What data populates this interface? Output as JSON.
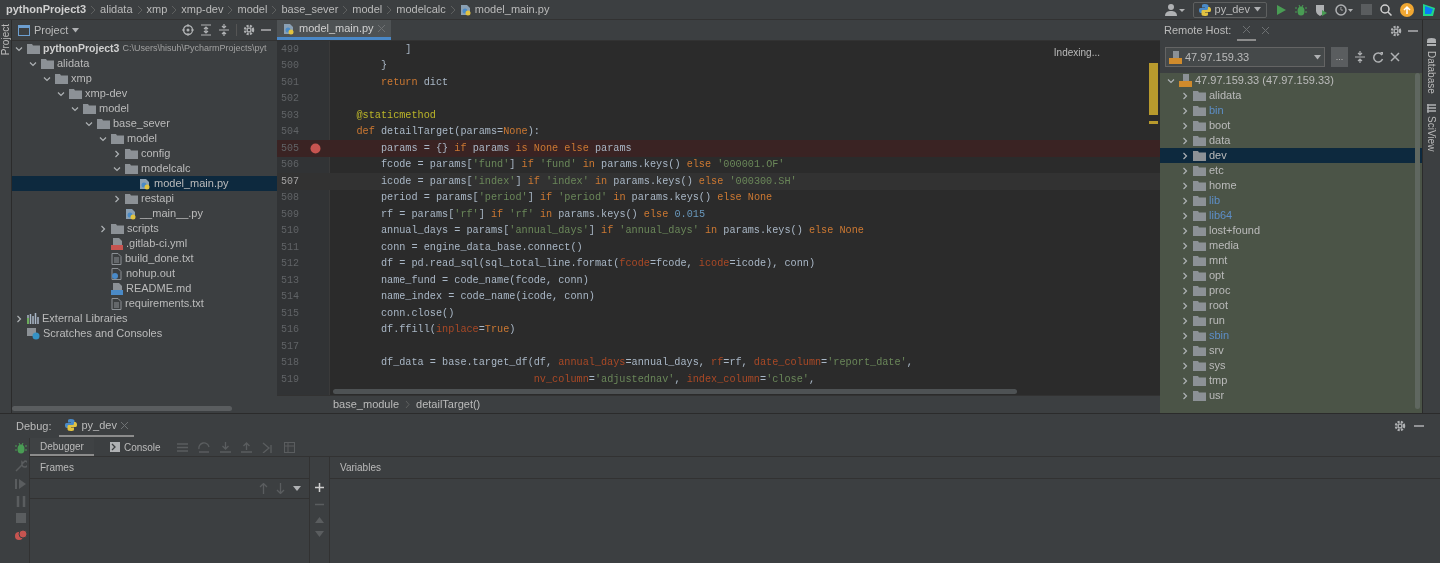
{
  "breadcrumbs": [
    {
      "label": "pythonProject3",
      "kind": "project"
    },
    {
      "label": "alidata",
      "kind": "folder"
    },
    {
      "label": "xmp",
      "kind": "folder"
    },
    {
      "label": "xmp-dev",
      "kind": "folder"
    },
    {
      "label": "model",
      "kind": "folder"
    },
    {
      "label": "base_sever",
      "kind": "folder"
    },
    {
      "label": "model",
      "kind": "folder"
    },
    {
      "label": "modelcalc",
      "kind": "folder"
    },
    {
      "label": "model_main.py",
      "kind": "pyfile"
    }
  ],
  "run_config": {
    "label": "py_dev"
  },
  "side_tab": "Project",
  "project_panel": {
    "title": "Project",
    "tree": [
      {
        "label": "pythonProject3",
        "path": "C:\\Users\\hisuh\\PycharmProjects\\pyt",
        "kind": "folder",
        "expanded": true,
        "selected": false,
        "children": [
          {
            "label": "alidata",
            "kind": "folder",
            "expanded": true,
            "selected": false,
            "children": [
              {
                "label": "xmp",
                "kind": "folder",
                "expanded": true,
                "selected": false,
                "children": [
                  {
                    "label": "xmp-dev",
                    "kind": "folder",
                    "expanded": true,
                    "selected": false,
                    "children": [
                      {
                        "label": "model",
                        "kind": "folder",
                        "expanded": true,
                        "selected": false,
                        "children": [
                          {
                            "label": "base_sever",
                            "kind": "folder",
                            "expanded": true,
                            "selected": false,
                            "children": [
                              {
                                "label": "model",
                                "kind": "folder",
                                "expanded": true,
                                "selected": false,
                                "children": [
                                  {
                                    "label": "config",
                                    "kind": "folder",
                                    "expanded": false,
                                    "selected": false
                                  },
                                  {
                                    "label": "modelcalc",
                                    "kind": "folder",
                                    "expanded": true,
                                    "selected": false,
                                    "children": [
                                      {
                                        "label": "model_main.py",
                                        "kind": "pyfile",
                                        "selected": true
                                      }
                                    ]
                                  },
                                  {
                                    "label": "restapi",
                                    "kind": "folder",
                                    "expanded": false,
                                    "selected": false
                                  },
                                  {
                                    "label": "__main__.py",
                                    "kind": "pyfile",
                                    "selected": false
                                  }
                                ]
                              },
                              {
                                "label": "scripts",
                                "kind": "folder",
                                "expanded": false,
                                "selected": false
                              },
                              {
                                "label": ".gitlab-ci.yml",
                                "kind": "yml",
                                "selected": false
                              },
                              {
                                "label": "build_done.txt",
                                "kind": "text",
                                "selected": false
                              },
                              {
                                "label": "nohup.out",
                                "kind": "out",
                                "selected": false
                              },
                              {
                                "label": "README.md",
                                "kind": "md",
                                "selected": false
                              },
                              {
                                "label": "requirements.txt",
                                "kind": "text",
                                "selected": false
                              }
                            ]
                          }
                        ]
                      }
                    ]
                  }
                ]
              }
            ]
          }
        ]
      },
      {
        "label": "External Libraries",
        "kind": "libraries",
        "expanded": false,
        "selected": false
      },
      {
        "label": "Scratches and Consoles",
        "kind": "scratches",
        "selected": false
      }
    ]
  },
  "editor": {
    "tabs": [
      {
        "label": "model_main.py",
        "selected": true
      }
    ],
    "status": "Indexing...",
    "lines": [
      {
        "number": "499",
        "breakpoint": false,
        "current": false,
        "tokens": [
          {
            "text": "            ]",
            "kind": "plain"
          }
        ]
      },
      {
        "number": "500",
        "breakpoint": false,
        "current": false,
        "tokens": [
          {
            "text": "        }",
            "kind": "plain"
          }
        ]
      },
      {
        "number": "501",
        "breakpoint": false,
        "current": false,
        "tokens": [
          {
            "text": "        return",
            "kind": "keyword"
          },
          {
            "text": " dict",
            "kind": "plain"
          }
        ]
      },
      {
        "number": "502",
        "breakpoint": false,
        "current": false
      },
      {
        "number": "503",
        "breakpoint": false,
        "current": false,
        "tokens": [
          {
            "text": "    @staticmethod",
            "kind": "decorator"
          }
        ]
      },
      {
        "number": "504",
        "breakpoint": false,
        "current": false,
        "tokens": [
          {
            "text": "    def",
            "kind": "keyword"
          },
          {
            "text": " detailTarget(params=",
            "kind": "plain"
          },
          {
            "text": "None",
            "kind": "keyword"
          },
          {
            "text": "):",
            "kind": "plain"
          }
        ]
      },
      {
        "number": "505",
        "breakpoint": true,
        "current": false,
        "tokens": [
          {
            "text": "        params = {} ",
            "kind": "plain"
          },
          {
            "text": "if",
            "kind": "keyword"
          },
          {
            "text": " params ",
            "kind": "plain"
          },
          {
            "text": "is None else",
            "kind": "keyword"
          },
          {
            "text": " params",
            "kind": "plain"
          }
        ]
      },
      {
        "number": "506",
        "breakpoint": false,
        "current": false,
        "tokens": [
          {
            "text": "        fcode = params[",
            "kind": "plain"
          },
          {
            "text": "'fund'",
            "kind": "string"
          },
          {
            "text": "] ",
            "kind": "plain"
          },
          {
            "text": "if",
            "kind": "keyword"
          },
          {
            "text": " 'fund' ",
            "kind": "string"
          },
          {
            "text": "in",
            "kind": "keyword"
          },
          {
            "text": " params.keys() ",
            "kind": "plain"
          },
          {
            "text": "else",
            "kind": "keyword"
          },
          {
            "text": " '000001.OF'",
            "kind": "string"
          }
        ]
      },
      {
        "number": "507",
        "breakpoint": false,
        "current": true,
        "tokens": [
          {
            "text": "        icode = params[",
            "kind": "plain"
          },
          {
            "text": "'index'",
            "kind": "string"
          },
          {
            "text": "] ",
            "kind": "plain"
          },
          {
            "text": "if",
            "kind": "keyword"
          },
          {
            "text": " 'index' ",
            "kind": "string"
          },
          {
            "text": "in",
            "kind": "keyword"
          },
          {
            "text": " params.keys() ",
            "kind": "plain"
          },
          {
            "text": "else",
            "kind": "keyword"
          },
          {
            "text": " '000300.SH'",
            "kind": "string"
          }
        ]
      },
      {
        "number": "508",
        "breakpoint": false,
        "current": false,
        "tokens": [
          {
            "text": "        period = params[",
            "kind": "plain"
          },
          {
            "text": "'period'",
            "kind": "string"
          },
          {
            "text": "] ",
            "kind": "plain"
          },
          {
            "text": "if",
            "kind": "keyword"
          },
          {
            "text": " 'period' ",
            "kind": "string"
          },
          {
            "text": "in",
            "kind": "keyword"
          },
          {
            "text": " params.keys() ",
            "kind": "plain"
          },
          {
            "text": "else None",
            "kind": "keyword"
          }
        ]
      },
      {
        "number": "509",
        "breakpoint": false,
        "current": false,
        "tokens": [
          {
            "text": "        rf = params[",
            "kind": "plain"
          },
          {
            "text": "'rf'",
            "kind": "string"
          },
          {
            "text": "] ",
            "kind": "plain"
          },
          {
            "text": "if",
            "kind": "keyword"
          },
          {
            "text": " 'rf' ",
            "kind": "string"
          },
          {
            "text": "in",
            "kind": "keyword"
          },
          {
            "text": " params.keys() ",
            "kind": "plain"
          },
          {
            "text": "else",
            "kind": "keyword"
          },
          {
            "text": " 0.015",
            "kind": "number"
          }
        ]
      },
      {
        "number": "510",
        "breakpoint": false,
        "current": false,
        "tokens": [
          {
            "text": "        annual_days = params[",
            "kind": "plain"
          },
          {
            "text": "'annual_days'",
            "kind": "string"
          },
          {
            "text": "] ",
            "kind": "plain"
          },
          {
            "text": "if",
            "kind": "keyword"
          },
          {
            "text": " 'annual_days' ",
            "kind": "string"
          },
          {
            "text": "in",
            "kind": "keyword"
          },
          {
            "text": " params.keys() ",
            "kind": "plain"
          },
          {
            "text": "else None",
            "kind": "keyword"
          }
        ]
      },
      {
        "number": "511",
        "breakpoint": false,
        "current": false,
        "tokens": [
          {
            "text": "        conn = engine_data_base.connect()",
            "kind": "plain"
          }
        ]
      },
      {
        "number": "512",
        "breakpoint": false,
        "current": false,
        "tokens": [
          {
            "text": "        df = pd.read_sql(sql_total_line.format(",
            "kind": "plain"
          },
          {
            "text": "fcode",
            "kind": "kwarg"
          },
          {
            "text": "=fcode, ",
            "kind": "plain"
          },
          {
            "text": "icode",
            "kind": "kwarg"
          },
          {
            "text": "=icode), conn)",
            "kind": "plain"
          }
        ]
      },
      {
        "number": "513",
        "breakpoint": false,
        "current": false,
        "tokens": [
          {
            "text": "        name_fund = code_name(fcode, conn)",
            "kind": "plain"
          }
        ]
      },
      {
        "number": "514",
        "breakpoint": false,
        "current": false,
        "tokens": [
          {
            "text": "        name_index = code_name(icode, conn)",
            "kind": "plain"
          }
        ]
      },
      {
        "number": "515",
        "breakpoint": false,
        "current": false,
        "tokens": [
          {
            "text": "        conn.close()",
            "kind": "plain"
          }
        ]
      },
      {
        "number": "516",
        "breakpoint": false,
        "current": false,
        "tokens": [
          {
            "text": "        df.ffill(",
            "kind": "plain"
          },
          {
            "text": "inplace",
            "kind": "kwarg"
          },
          {
            "text": "=",
            "kind": "plain"
          },
          {
            "text": "True",
            "kind": "keyword"
          },
          {
            "text": ")",
            "kind": "plain"
          }
        ]
      },
      {
        "number": "517",
        "breakpoint": false,
        "current": false
      },
      {
        "number": "518",
        "breakpoint": false,
        "current": false,
        "tokens": [
          {
            "text": "        df_data = base.target_df(df, ",
            "kind": "plain"
          },
          {
            "text": "annual_days",
            "kind": "kwarg"
          },
          {
            "text": "=annual_days, ",
            "kind": "plain"
          },
          {
            "text": "rf",
            "kind": "kwarg"
          },
          {
            "text": "=rf, ",
            "kind": "plain"
          },
          {
            "text": "date_column",
            "kind": "kwarg"
          },
          {
            "text": "=",
            "kind": "plain"
          },
          {
            "text": "'report_date'",
            "kind": "string"
          },
          {
            "text": ",",
            "kind": "plain"
          }
        ]
      },
      {
        "number": "519",
        "breakpoint": false,
        "current": false,
        "tokens": [
          {
            "text": "                                 nv_column",
            "kind": "kwarg"
          },
          {
            "text": "=",
            "kind": "plain"
          },
          {
            "text": "'adjustednav'",
            "kind": "string"
          },
          {
            "text": ", ",
            "kind": "plain"
          },
          {
            "text": "index_column",
            "kind": "kwarg"
          },
          {
            "text": "=",
            "kind": "plain"
          },
          {
            "text": "'close'",
            "kind": "string"
          },
          {
            "text": ",",
            "kind": "plain"
          }
        ]
      }
    ],
    "breadcrumbs": [
      "base_module",
      "detailTarget()"
    ]
  },
  "remote_host": {
    "title": "Remote Host:",
    "host": "47.97.159.33",
    "more": "...",
    "root": {
      "label": "47.97.159.33 (47.97.159.33)",
      "expanded": true,
      "children": [
        {
          "label": "alidata",
          "symlink": false,
          "selected": false
        },
        {
          "label": "bin",
          "symlink": true,
          "selected": false
        },
        {
          "label": "boot",
          "symlink": false,
          "selected": false
        },
        {
          "label": "data",
          "symlink": false,
          "selected": false
        },
        {
          "label": "dev",
          "symlink": false,
          "selected": true
        },
        {
          "label": "etc",
          "symlink": false,
          "selected": false
        },
        {
          "label": "home",
          "symlink": false,
          "selected": false
        },
        {
          "label": "lib",
          "symlink": true,
          "selected": false
        },
        {
          "label": "lib64",
          "symlink": true,
          "selected": false
        },
        {
          "label": "lost+found",
          "symlink": false,
          "selected": false
        },
        {
          "label": "media",
          "symlink": false,
          "selected": false
        },
        {
          "label": "mnt",
          "symlink": false,
          "selected": false
        },
        {
          "label": "opt",
          "symlink": false,
          "selected": false
        },
        {
          "label": "proc",
          "symlink": false,
          "selected": false
        },
        {
          "label": "root",
          "symlink": false,
          "selected": false
        },
        {
          "label": "run",
          "symlink": false,
          "selected": false
        },
        {
          "label": "sbin",
          "symlink": true,
          "selected": false
        },
        {
          "label": "srv",
          "symlink": false,
          "selected": false
        },
        {
          "label": "sys",
          "symlink": false,
          "selected": false
        },
        {
          "label": "tmp",
          "symlink": false,
          "selected": false
        },
        {
          "label": "usr",
          "symlink": false,
          "selected": false
        }
      ]
    }
  },
  "right_tabs": [
    {
      "label": "Database",
      "kind": "database"
    },
    {
      "label": "SciView",
      "kind": "sciview"
    }
  ],
  "debug": {
    "title": "Debug:",
    "tabs": [
      {
        "label": "py_dev",
        "selected": true
      }
    ],
    "subtabs": [
      {
        "label": "Debugger",
        "kind": "debugger",
        "selected": true
      },
      {
        "label": "Console",
        "kind": "console",
        "selected": false
      }
    ],
    "frames_title": "Frames",
    "variables_title": "Variables"
  }
}
